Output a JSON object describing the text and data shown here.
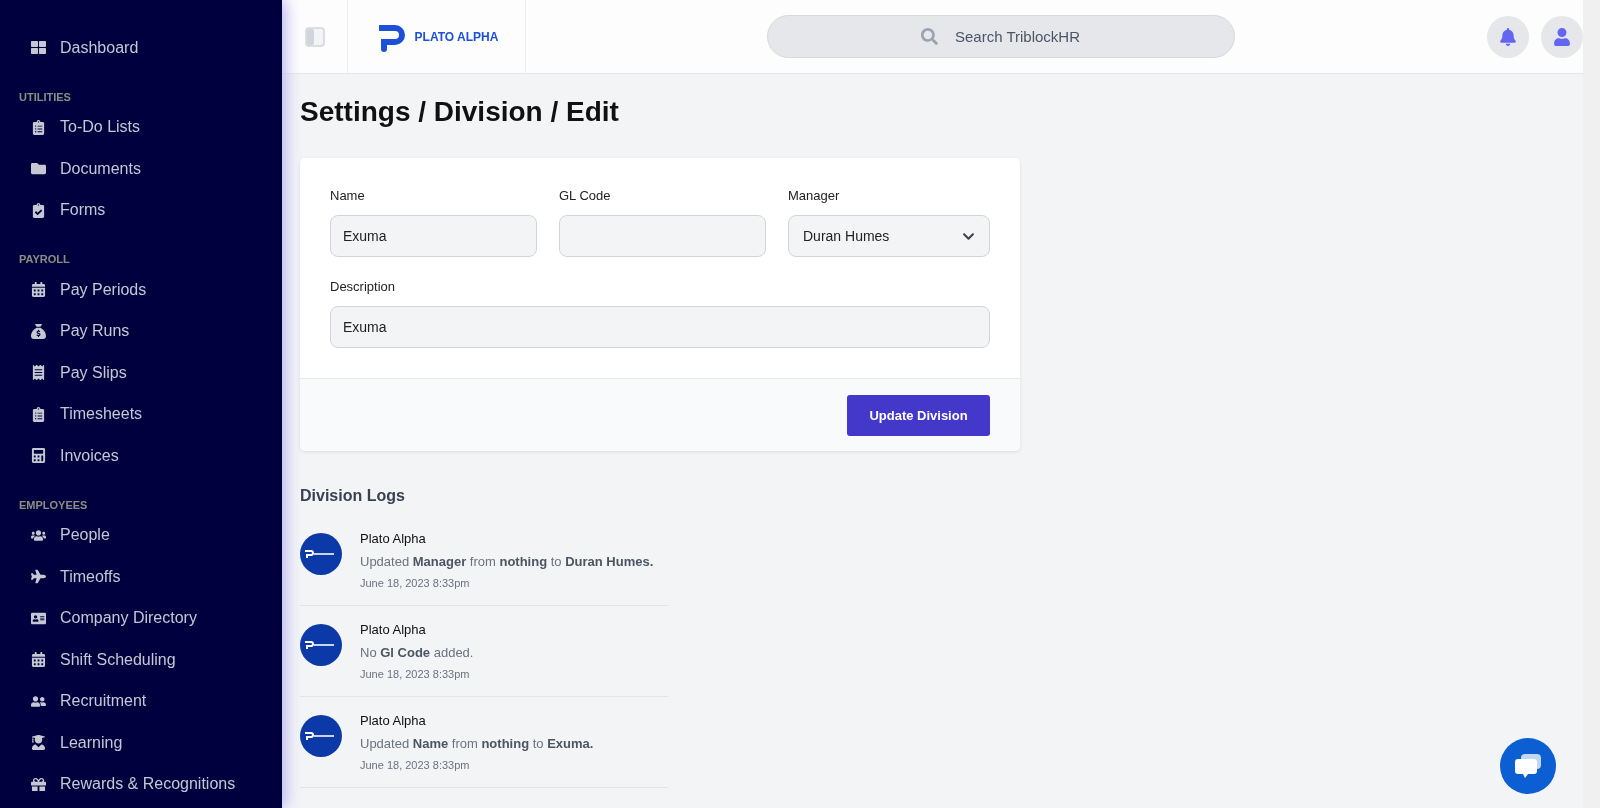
{
  "sidebar": {
    "items": [
      {
        "kind": "item",
        "label": "Dashboard"
      },
      {
        "kind": "section",
        "label": "UTILITIES"
      },
      {
        "kind": "item",
        "label": "To-Do Lists"
      },
      {
        "kind": "item",
        "label": "Documents"
      },
      {
        "kind": "item",
        "label": "Forms"
      },
      {
        "kind": "section",
        "label": "PAYROLL"
      },
      {
        "kind": "item",
        "label": "Pay Periods"
      },
      {
        "kind": "item",
        "label": "Pay Runs"
      },
      {
        "kind": "item",
        "label": "Pay Slips"
      },
      {
        "kind": "item",
        "label": "Timesheets"
      },
      {
        "kind": "item",
        "label": "Invoices"
      },
      {
        "kind": "section",
        "label": "EMPLOYEES"
      },
      {
        "kind": "item",
        "label": "People"
      },
      {
        "kind": "item",
        "label": "Timeoffs"
      },
      {
        "kind": "item",
        "label": "Company Directory"
      },
      {
        "kind": "item",
        "label": "Shift Scheduling"
      },
      {
        "kind": "item",
        "label": "Recruitment"
      },
      {
        "kind": "item",
        "label": "Learning"
      },
      {
        "kind": "item",
        "label": "Rewards & Recognitions"
      }
    ]
  },
  "header": {
    "logo_text": "PLATO ALPHA",
    "search": {
      "placeholder": "Search TriblockHR"
    }
  },
  "page_title": "Settings / Division / Edit",
  "form": {
    "fields": [
      {
        "kind": "text",
        "label": "Name",
        "value": "Exuma"
      },
      {
        "kind": "text",
        "label": "GL Code"
      },
      {
        "kind": "select",
        "label": "Manager",
        "value": "Duran Humes"
      },
      {
        "kind": "text",
        "label": "Description",
        "value": "Exuma"
      }
    ],
    "submit": "Update Division"
  },
  "logs": {
    "title": "Division Logs",
    "entries": [
      {
        "author": "Plato Alpha",
        "message": "Updated **Manager** from **nothing** to **Duran Humes.**",
        "time": "June 18, 2023 8:33pm"
      },
      {
        "author": "Plato Alpha",
        "message": "No **Gl Code** added.",
        "time": "June 18, 2023 8:33pm"
      },
      {
        "author": "Plato Alpha",
        "message": "Updated **Name** from **nothing** to **Exuma.**",
        "time": "June 18, 2023 8:33pm"
      }
    ]
  }
}
